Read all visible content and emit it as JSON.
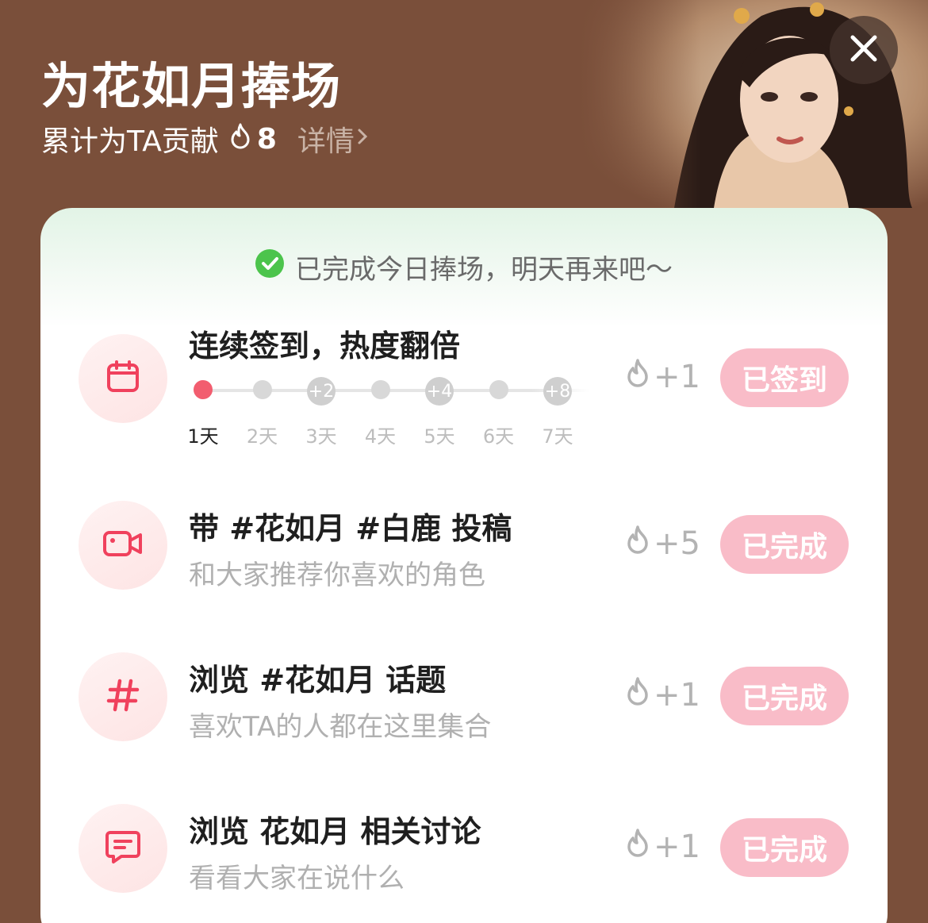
{
  "header": {
    "title": "为花如月捧场",
    "contribution_label": "累计为TA贡献",
    "contribution_count": "8",
    "detail_link": "详情"
  },
  "notice": "已完成今日捧场，明天再来吧～",
  "tasks": [
    {
      "title": "连续签到，热度翻倍",
      "subtitle": "",
      "reward": "+1",
      "button": "已签到",
      "icon": "calendar-icon"
    },
    {
      "title": "带 #花如月 #白鹿 投稿",
      "subtitle": "和大家推荐你喜欢的角色",
      "reward": "+5",
      "button": "已完成",
      "icon": "video-camera-icon"
    },
    {
      "title": "浏览 #花如月 话题",
      "subtitle": "喜欢TA的人都在这里集合",
      "reward": "+1",
      "button": "已完成",
      "icon": "hashtag-icon"
    },
    {
      "title": "浏览 花如月 相关讨论",
      "subtitle": "看看大家在说什么",
      "reward": "+1",
      "button": "已完成",
      "icon": "chat-bubble-icon"
    }
  ],
  "streak": {
    "days": [
      "1天",
      "2天",
      "3天",
      "4天",
      "5天",
      "6天",
      "7天"
    ],
    "bonuses": [
      "",
      "",
      "+2",
      "",
      "+4",
      "",
      "+8"
    ],
    "completed_days": 1
  },
  "colors": {
    "background": "#7a4f3a",
    "accent": "#f25d6f",
    "button_done": "#f9bcc8",
    "check": "#4cc44c"
  }
}
